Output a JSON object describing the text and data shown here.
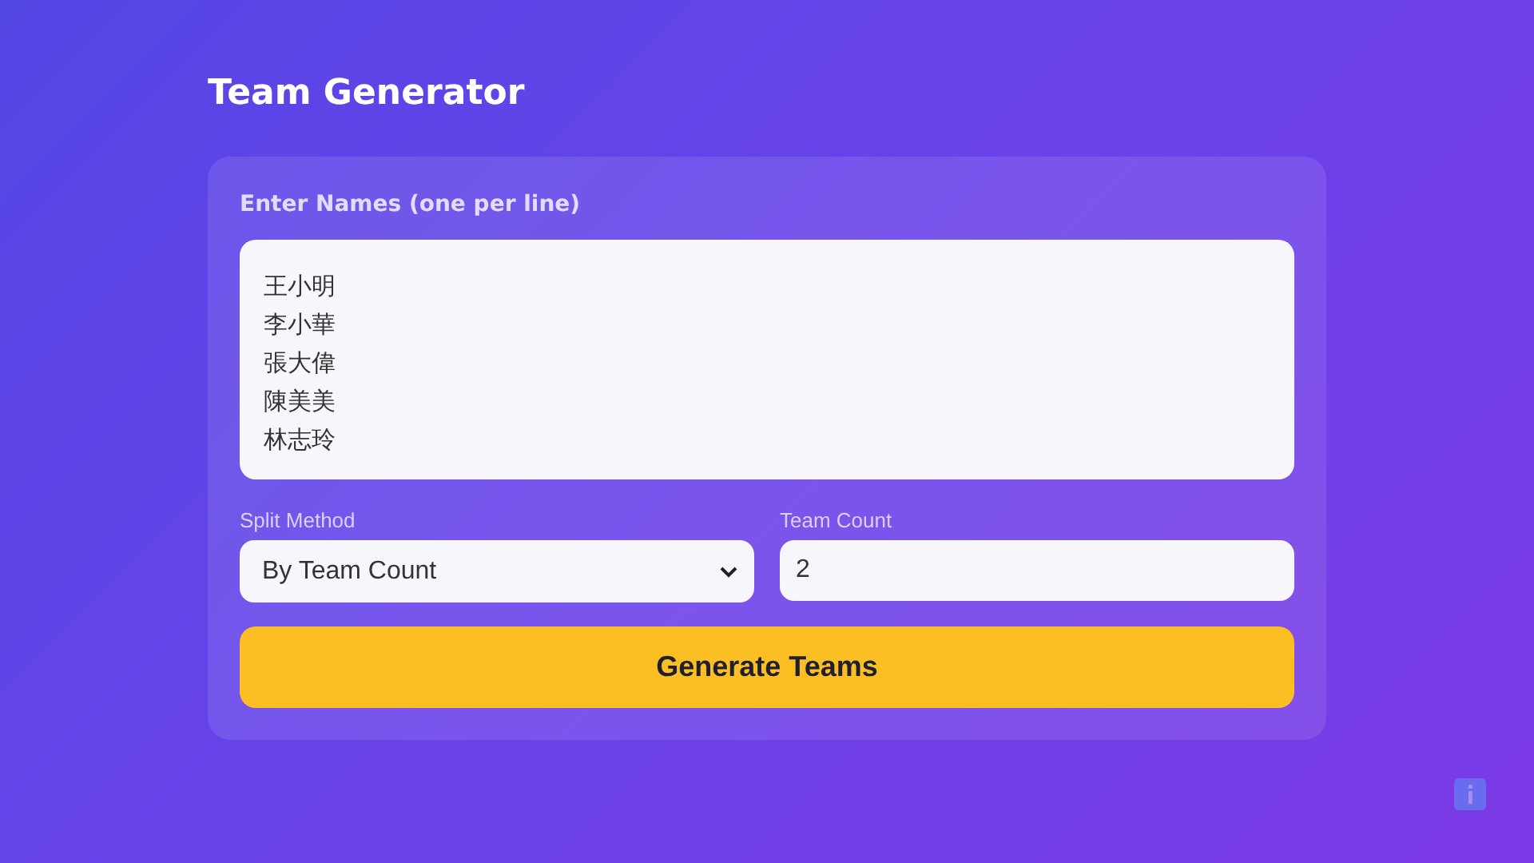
{
  "title": "Team Generator",
  "names_field": {
    "label": "Enter Names (one per line)",
    "lines": [
      "王小明",
      "李小華",
      "張大偉",
      "陳美美",
      "林志玲"
    ]
  },
  "split_method": {
    "label": "Split Method",
    "value": "By Team Count"
  },
  "team_count": {
    "label": "Team Count",
    "value": "2"
  },
  "generate_button": {
    "label": "Generate Teams"
  }
}
